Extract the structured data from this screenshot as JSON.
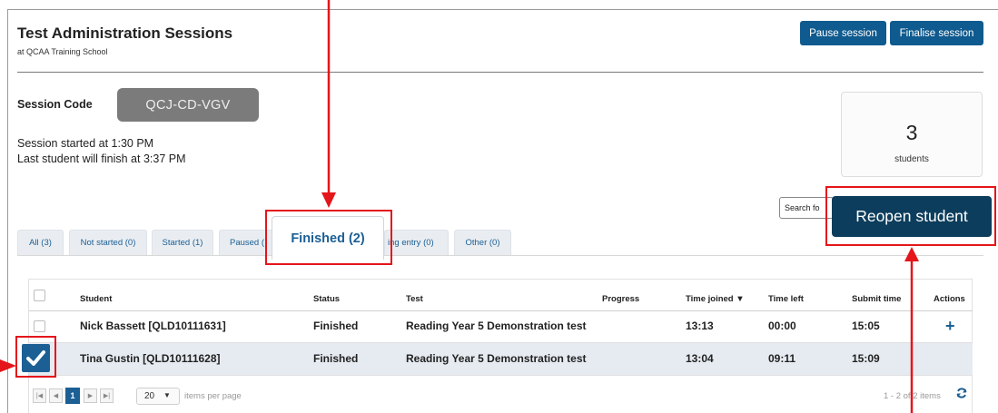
{
  "header": {
    "title": "Test Administration Sessions",
    "subtitle": "at QCAA Training School",
    "pause_label": "Pause session",
    "finalise_label": "Finalise session"
  },
  "session": {
    "code_label": "Session Code",
    "code": "QCJ-CD-VGV",
    "started": "Session started at 1:30 PM",
    "last_finish": "Last student will finish at 3:37 PM",
    "count": "3",
    "count_label": "students"
  },
  "search": {
    "text": "Search fo"
  },
  "tabs": [
    {
      "label": "All (3)"
    },
    {
      "label": "Not started (0)"
    },
    {
      "label": "Started (1)"
    },
    {
      "label": "Paused ("
    },
    {
      "label": "Finished (2)"
    },
    {
      "label": "ing entry (0)"
    },
    {
      "label": "Other (0)"
    }
  ],
  "reopen_label": "Reopen student",
  "table": {
    "columns": [
      "Student",
      "Status",
      "Test",
      "Progress",
      "Time joined ▼",
      "Time left",
      "Submit time",
      "Actions"
    ],
    "rows": [
      {
        "student": "Nick Bassett [QLD10111631]",
        "status": "Finished",
        "test": "Reading Year 5 Demonstration test",
        "joined": "13:13",
        "left": "00:00",
        "submit": "15:05",
        "selected": false
      },
      {
        "student": "Tina Gustin [QLD10111628]",
        "status": "Finished",
        "test": "Reading Year 5 Demonstration test",
        "joined": "13:04",
        "left": "09:11",
        "submit": "15:09",
        "selected": true
      }
    ]
  },
  "pager": {
    "current": "1",
    "page_size": "20",
    "per_page_text": "items per page",
    "count_text": "1 - 2 of 2 items"
  },
  "icons": [
    "first-page-icon",
    "prev-page-icon",
    "next-page-icon",
    "last-page-icon",
    "caret-down-icon",
    "plus-icon",
    "refresh-icon",
    "check-icon",
    "sort-down-icon"
  ],
  "colors": {
    "primary": "#0f5a8e",
    "reopen": "#0c3d5c",
    "highlight": "#e4151b",
    "code_box": "#7b7b7b",
    "selected_row": "#e6ebf1"
  }
}
